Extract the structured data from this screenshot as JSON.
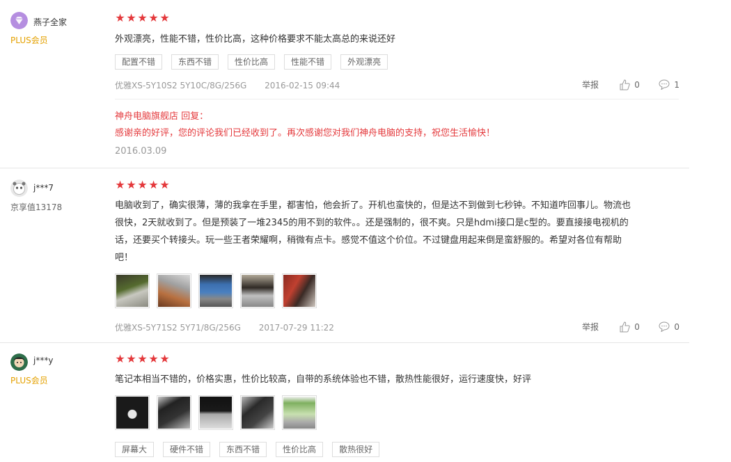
{
  "reviews": [
    {
      "user": {
        "name": "燕子全家",
        "level": "PLUS会员",
        "avatar_icon": "diamond-avatar-icon"
      },
      "rating": 5,
      "content": "外观漂亮，性能不错，性价比高，这种价格要求不能太高总的来说还好",
      "tags": [
        "配置不错",
        "东西不错",
        "性价比高",
        "性能不错",
        "外观漂亮"
      ],
      "product": "优雅XS-5Y10S2 5Y10C/8G/256G",
      "date": "2016-02-15 09:44",
      "report_label": "举报",
      "likes": "0",
      "replies": "1",
      "shop_reply": {
        "header": "神舟电脑旗舰店 回复：",
        "text": "感谢亲的好评，您的评论我们已经收到了。再次感谢您对我们神舟电脑的支持，祝您生活愉快！",
        "date": "2016.03.09"
      }
    },
    {
      "user": {
        "name": "j***7",
        "level": "京享值13178",
        "avatar_icon": "panda-avatar-icon"
      },
      "rating": 5,
      "content_lines": [
        "电脑收到了，确实很薄，薄的我拿在手里，都害怕，他会折了。开机也蛮快的，但是达不到做到七秒钟。不知道咋回事儿。物流也",
        "很快，2天就收到了。但是预装了一堆2345的用不到的软件。。还是强制的，很不爽。只是hdmi接口是c型的。要直接接电视机的",
        "话，还要买个转接头。玩一些王者荣耀啊，稍微有点卡。感觉不值这个价位。不过键盘用起来倒是蛮舒服的。希望对各位有帮助",
        "吧！"
      ],
      "photos": [
        "laptop-desktop-photo",
        "laptop-hand-photo",
        "laptop-windows-photo",
        "laptop-side-photo",
        "laptop-red-photo"
      ],
      "product": "优雅XS-5Y71S2 5Y71/8G/256G",
      "date": "2017-07-29 11:22",
      "report_label": "举报",
      "likes": "0",
      "replies": "0"
    },
    {
      "user": {
        "name": "j***y",
        "level": "PLUS会员",
        "avatar_icon": "cartoon-avatar-icon"
      },
      "rating": 5,
      "content": "笔记本相当不错的，价格实惠，性价比较高，自带的系统体验也不错，散热性能很好，运行速度快，好评",
      "photos": [
        "laptop-logo-photo",
        "laptop-open-photo",
        "laptop-screen-photo",
        "laptop-angle-photo",
        "laptop-green-photo"
      ],
      "tags": [
        "屏幕大",
        "硬件不错",
        "东西不错",
        "性价比高",
        "散热很好"
      ]
    }
  ],
  "colors": {
    "star": "#e4393c",
    "plus": "#e4a100",
    "reply": "#e4393c"
  }
}
